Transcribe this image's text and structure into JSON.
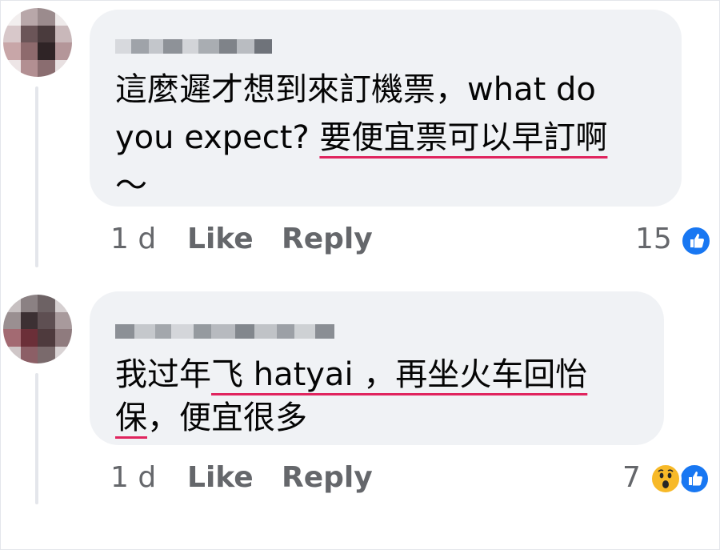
{
  "comments": [
    {
      "author_redacted": true,
      "text_lines": [
        [
          "這麼遲才想到來訂機票，what do"
        ],
        [
          "you expect? ",
          "要便宜票可以早訂啊"
        ],
        [
          "～"
        ]
      ],
      "time": "1 d",
      "like_label": "Like",
      "reply_label": "Reply",
      "reaction_count": "15",
      "reactions": [
        "like-icon"
      ]
    },
    {
      "author_redacted": true,
      "text_lines": [
        [
          "我过年",
          "飞 hatyai ，再坐火车回怡"
        ],
        [
          "保",
          "，便宜很多"
        ]
      ],
      "time": "1 d",
      "like_label": "Like",
      "reply_label": "Reply",
      "reaction_count": "7",
      "reactions": [
        "wow-icon",
        "like-icon"
      ]
    }
  ],
  "colors": {
    "bubble": "#f0f2f5",
    "spellcheck_underline": "#e0245e",
    "meta_text": "#65676b",
    "like_blue": "#1877f2",
    "wow_yellow": "#f7b928"
  }
}
